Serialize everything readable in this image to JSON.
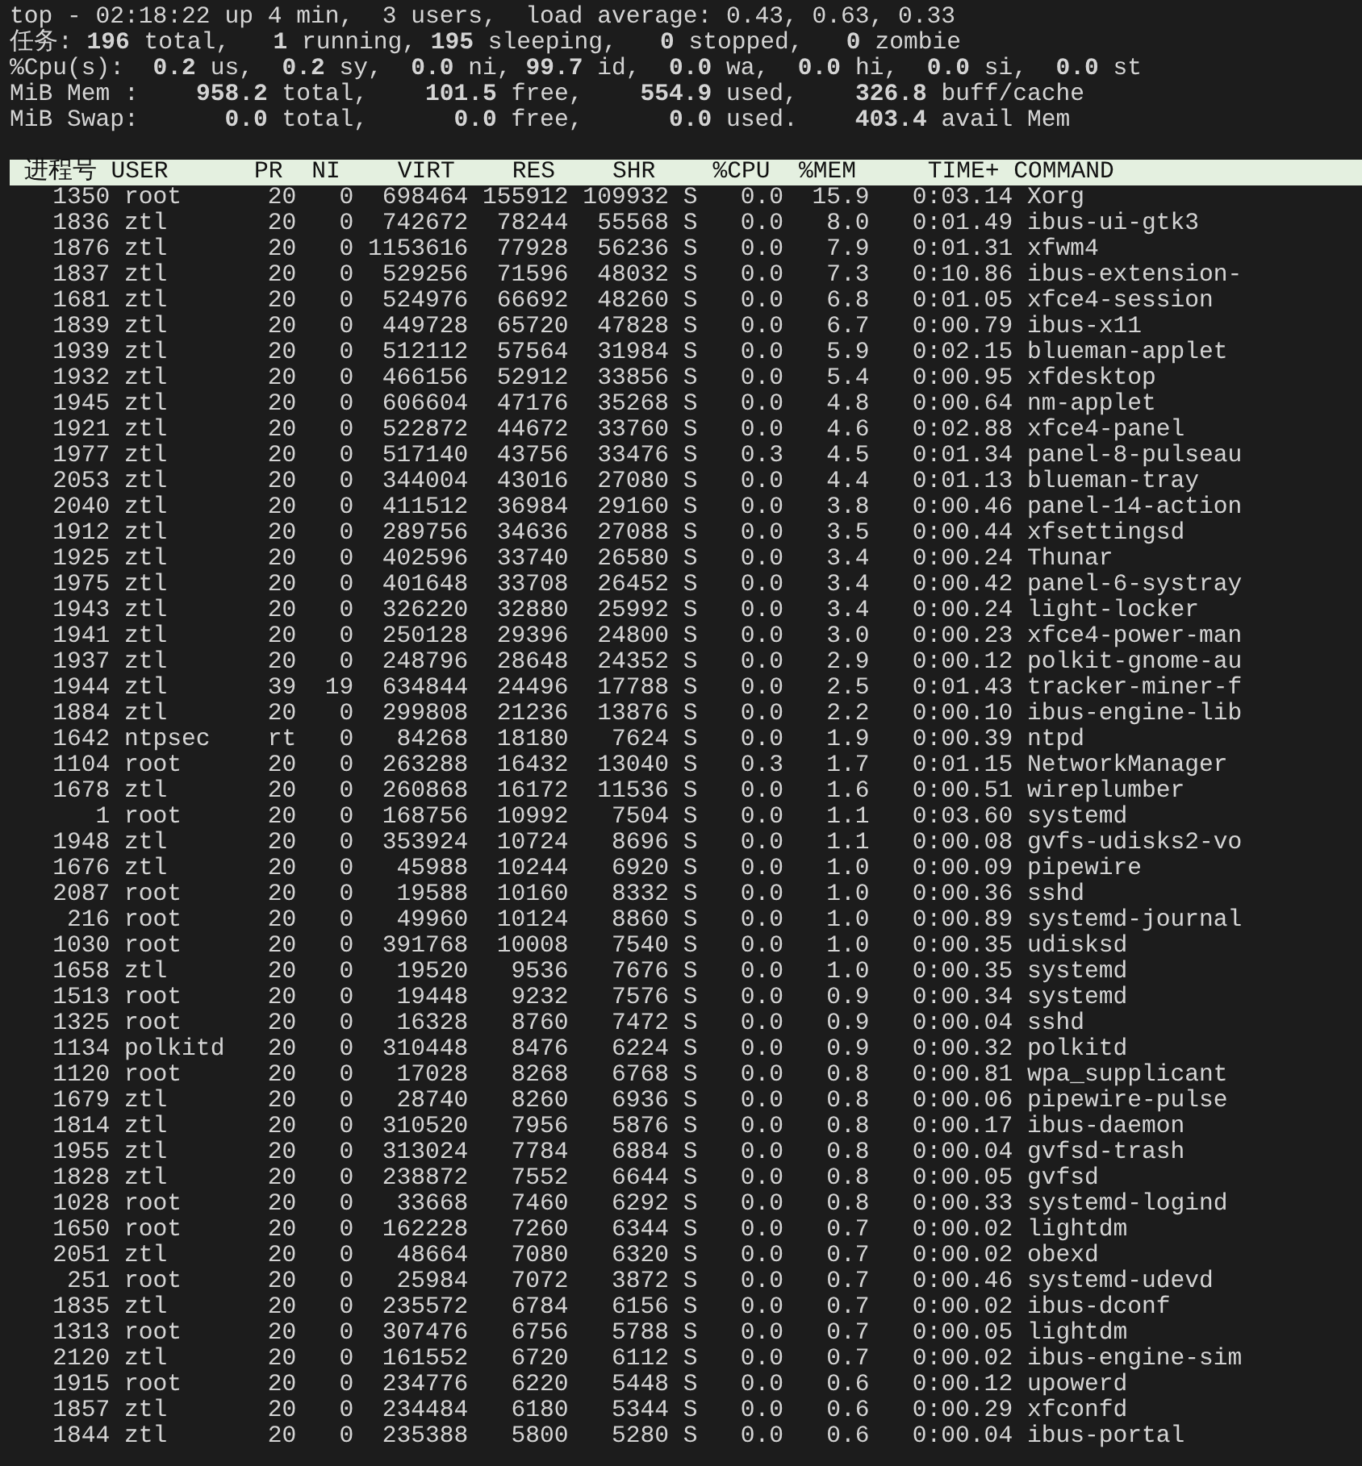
{
  "summary": [
    "top - 02:18:22 up 4 min,  3 users,  load average: 0.43, 0.63, 0.33",
    "任务: **196** total,   **1** running, **195** sleeping,   **0** stopped,   **0** zombie",
    "%Cpu(s):  **0.2** us,  **0.2** sy,  **0.0** ni, **99.7** id,  **0.0** wa,  **0.0** hi,  **0.0** si,  **0.0** st",
    "MiB Mem :    **958.2** total,    **101.5** free,    **554.9** used,    **326.8** buff/cache",
    "MiB Swap:      **0.0** total,      **0.0** free,      **0.0** used.    **403.4** avail Mem"
  ],
  "columns": [
    "进程号",
    "USER",
    "PR",
    "NI",
    "VIRT",
    "RES",
    "SHR",
    "%CPU",
    "%MEM",
    "TIME+",
    "COMMAND"
  ],
  "rows": [
    {
      "pid": "1350",
      "user": "root",
      "pr": "20",
      "ni": "0",
      "virt": "698464",
      "res": "155912",
      "shr": "109932",
      "s": "S",
      "cpu": "0.0",
      "mem": "15.9",
      "time": "0:03.14",
      "command": "Xorg"
    },
    {
      "pid": "1836",
      "user": "ztl",
      "pr": "20",
      "ni": "0",
      "virt": "742672",
      "res": "78244",
      "shr": "55568",
      "s": "S",
      "cpu": "0.0",
      "mem": "8.0",
      "time": "0:01.49",
      "command": "ibus-ui-gtk3"
    },
    {
      "pid": "1876",
      "user": "ztl",
      "pr": "20",
      "ni": "0",
      "virt": "1153616",
      "res": "77928",
      "shr": "56236",
      "s": "S",
      "cpu": "0.0",
      "mem": "7.9",
      "time": "0:01.31",
      "command": "xfwm4"
    },
    {
      "pid": "1837",
      "user": "ztl",
      "pr": "20",
      "ni": "0",
      "virt": "529256",
      "res": "71596",
      "shr": "48032",
      "s": "S",
      "cpu": "0.0",
      "mem": "7.3",
      "time": "0:10.86",
      "command": "ibus-extension-"
    },
    {
      "pid": "1681",
      "user": "ztl",
      "pr": "20",
      "ni": "0",
      "virt": "524976",
      "res": "66692",
      "shr": "48260",
      "s": "S",
      "cpu": "0.0",
      "mem": "6.8",
      "time": "0:01.05",
      "command": "xfce4-session"
    },
    {
      "pid": "1839",
      "user": "ztl",
      "pr": "20",
      "ni": "0",
      "virt": "449728",
      "res": "65720",
      "shr": "47828",
      "s": "S",
      "cpu": "0.0",
      "mem": "6.7",
      "time": "0:00.79",
      "command": "ibus-x11"
    },
    {
      "pid": "1939",
      "user": "ztl",
      "pr": "20",
      "ni": "0",
      "virt": "512112",
      "res": "57564",
      "shr": "31984",
      "s": "S",
      "cpu": "0.0",
      "mem": "5.9",
      "time": "0:02.15",
      "command": "blueman-applet"
    },
    {
      "pid": "1932",
      "user": "ztl",
      "pr": "20",
      "ni": "0",
      "virt": "466156",
      "res": "52912",
      "shr": "33856",
      "s": "S",
      "cpu": "0.0",
      "mem": "5.4",
      "time": "0:00.95",
      "command": "xfdesktop"
    },
    {
      "pid": "1945",
      "user": "ztl",
      "pr": "20",
      "ni": "0",
      "virt": "606604",
      "res": "47176",
      "shr": "35268",
      "s": "S",
      "cpu": "0.0",
      "mem": "4.8",
      "time": "0:00.64",
      "command": "nm-applet"
    },
    {
      "pid": "1921",
      "user": "ztl",
      "pr": "20",
      "ni": "0",
      "virt": "522872",
      "res": "44672",
      "shr": "33760",
      "s": "S",
      "cpu": "0.0",
      "mem": "4.6",
      "time": "0:02.88",
      "command": "xfce4-panel"
    },
    {
      "pid": "1977",
      "user": "ztl",
      "pr": "20",
      "ni": "0",
      "virt": "517140",
      "res": "43756",
      "shr": "33476",
      "s": "S",
      "cpu": "0.3",
      "mem": "4.5",
      "time": "0:01.34",
      "command": "panel-8-pulseau"
    },
    {
      "pid": "2053",
      "user": "ztl",
      "pr": "20",
      "ni": "0",
      "virt": "344004",
      "res": "43016",
      "shr": "27080",
      "s": "S",
      "cpu": "0.0",
      "mem": "4.4",
      "time": "0:01.13",
      "command": "blueman-tray"
    },
    {
      "pid": "2040",
      "user": "ztl",
      "pr": "20",
      "ni": "0",
      "virt": "411512",
      "res": "36984",
      "shr": "29160",
      "s": "S",
      "cpu": "0.0",
      "mem": "3.8",
      "time": "0:00.46",
      "command": "panel-14-action"
    },
    {
      "pid": "1912",
      "user": "ztl",
      "pr": "20",
      "ni": "0",
      "virt": "289756",
      "res": "34636",
      "shr": "27088",
      "s": "S",
      "cpu": "0.0",
      "mem": "3.5",
      "time": "0:00.44",
      "command": "xfsettingsd"
    },
    {
      "pid": "1925",
      "user": "ztl",
      "pr": "20",
      "ni": "0",
      "virt": "402596",
      "res": "33740",
      "shr": "26580",
      "s": "S",
      "cpu": "0.0",
      "mem": "3.4",
      "time": "0:00.24",
      "command": "Thunar"
    },
    {
      "pid": "1975",
      "user": "ztl",
      "pr": "20",
      "ni": "0",
      "virt": "401648",
      "res": "33708",
      "shr": "26452",
      "s": "S",
      "cpu": "0.0",
      "mem": "3.4",
      "time": "0:00.42",
      "command": "panel-6-systray"
    },
    {
      "pid": "1943",
      "user": "ztl",
      "pr": "20",
      "ni": "0",
      "virt": "326220",
      "res": "32880",
      "shr": "25992",
      "s": "S",
      "cpu": "0.0",
      "mem": "3.4",
      "time": "0:00.24",
      "command": "light-locker"
    },
    {
      "pid": "1941",
      "user": "ztl",
      "pr": "20",
      "ni": "0",
      "virt": "250128",
      "res": "29396",
      "shr": "24800",
      "s": "S",
      "cpu": "0.0",
      "mem": "3.0",
      "time": "0:00.23",
      "command": "xfce4-power-man"
    },
    {
      "pid": "1937",
      "user": "ztl",
      "pr": "20",
      "ni": "0",
      "virt": "248796",
      "res": "28648",
      "shr": "24352",
      "s": "S",
      "cpu": "0.0",
      "mem": "2.9",
      "time": "0:00.12",
      "command": "polkit-gnome-au"
    },
    {
      "pid": "1944",
      "user": "ztl",
      "pr": "39",
      "ni": "19",
      "virt": "634844",
      "res": "24496",
      "shr": "17788",
      "s": "S",
      "cpu": "0.0",
      "mem": "2.5",
      "time": "0:01.43",
      "command": "tracker-miner-f"
    },
    {
      "pid": "1884",
      "user": "ztl",
      "pr": "20",
      "ni": "0",
      "virt": "299808",
      "res": "21236",
      "shr": "13876",
      "s": "S",
      "cpu": "0.0",
      "mem": "2.2",
      "time": "0:00.10",
      "command": "ibus-engine-lib"
    },
    {
      "pid": "1642",
      "user": "ntpsec",
      "pr": "rt",
      "ni": "0",
      "virt": "84268",
      "res": "18180",
      "shr": "7624",
      "s": "S",
      "cpu": "0.0",
      "mem": "1.9",
      "time": "0:00.39",
      "command": "ntpd"
    },
    {
      "pid": "1104",
      "user": "root",
      "pr": "20",
      "ni": "0",
      "virt": "263288",
      "res": "16432",
      "shr": "13040",
      "s": "S",
      "cpu": "0.3",
      "mem": "1.7",
      "time": "0:01.15",
      "command": "NetworkManager"
    },
    {
      "pid": "1678",
      "user": "ztl",
      "pr": "20",
      "ni": "0",
      "virt": "260868",
      "res": "16172",
      "shr": "11536",
      "s": "S",
      "cpu": "0.0",
      "mem": "1.6",
      "time": "0:00.51",
      "command": "wireplumber"
    },
    {
      "pid": "1",
      "user": "root",
      "pr": "20",
      "ni": "0",
      "virt": "168756",
      "res": "10992",
      "shr": "7504",
      "s": "S",
      "cpu": "0.0",
      "mem": "1.1",
      "time": "0:03.60",
      "command": "systemd"
    },
    {
      "pid": "1948",
      "user": "ztl",
      "pr": "20",
      "ni": "0",
      "virt": "353924",
      "res": "10724",
      "shr": "8696",
      "s": "S",
      "cpu": "0.0",
      "mem": "1.1",
      "time": "0:00.08",
      "command": "gvfs-udisks2-vo"
    },
    {
      "pid": "1676",
      "user": "ztl",
      "pr": "20",
      "ni": "0",
      "virt": "45988",
      "res": "10244",
      "shr": "6920",
      "s": "S",
      "cpu": "0.0",
      "mem": "1.0",
      "time": "0:00.09",
      "command": "pipewire"
    },
    {
      "pid": "2087",
      "user": "root",
      "pr": "20",
      "ni": "0",
      "virt": "19588",
      "res": "10160",
      "shr": "8332",
      "s": "S",
      "cpu": "0.0",
      "mem": "1.0",
      "time": "0:00.36",
      "command": "sshd"
    },
    {
      "pid": "216",
      "user": "root",
      "pr": "20",
      "ni": "0",
      "virt": "49960",
      "res": "10124",
      "shr": "8860",
      "s": "S",
      "cpu": "0.0",
      "mem": "1.0",
      "time": "0:00.89",
      "command": "systemd-journal"
    },
    {
      "pid": "1030",
      "user": "root",
      "pr": "20",
      "ni": "0",
      "virt": "391768",
      "res": "10008",
      "shr": "7540",
      "s": "S",
      "cpu": "0.0",
      "mem": "1.0",
      "time": "0:00.35",
      "command": "udisksd"
    },
    {
      "pid": "1658",
      "user": "ztl",
      "pr": "20",
      "ni": "0",
      "virt": "19520",
      "res": "9536",
      "shr": "7676",
      "s": "S",
      "cpu": "0.0",
      "mem": "1.0",
      "time": "0:00.35",
      "command": "systemd"
    },
    {
      "pid": "1513",
      "user": "root",
      "pr": "20",
      "ni": "0",
      "virt": "19448",
      "res": "9232",
      "shr": "7576",
      "s": "S",
      "cpu": "0.0",
      "mem": "0.9",
      "time": "0:00.34",
      "command": "systemd"
    },
    {
      "pid": "1325",
      "user": "root",
      "pr": "20",
      "ni": "0",
      "virt": "16328",
      "res": "8760",
      "shr": "7472",
      "s": "S",
      "cpu": "0.0",
      "mem": "0.9",
      "time": "0:00.04",
      "command": "sshd"
    },
    {
      "pid": "1134",
      "user": "polkitd",
      "pr": "20",
      "ni": "0",
      "virt": "310448",
      "res": "8476",
      "shr": "6224",
      "s": "S",
      "cpu": "0.0",
      "mem": "0.9",
      "time": "0:00.32",
      "command": "polkitd"
    },
    {
      "pid": "1120",
      "user": "root",
      "pr": "20",
      "ni": "0",
      "virt": "17028",
      "res": "8268",
      "shr": "6768",
      "s": "S",
      "cpu": "0.0",
      "mem": "0.8",
      "time": "0:00.81",
      "command": "wpa_supplicant"
    },
    {
      "pid": "1679",
      "user": "ztl",
      "pr": "20",
      "ni": "0",
      "virt": "28740",
      "res": "8260",
      "shr": "6936",
      "s": "S",
      "cpu": "0.0",
      "mem": "0.8",
      "time": "0:00.06",
      "command": "pipewire-pulse"
    },
    {
      "pid": "1814",
      "user": "ztl",
      "pr": "20",
      "ni": "0",
      "virt": "310520",
      "res": "7956",
      "shr": "5876",
      "s": "S",
      "cpu": "0.0",
      "mem": "0.8",
      "time": "0:00.17",
      "command": "ibus-daemon"
    },
    {
      "pid": "1955",
      "user": "ztl",
      "pr": "20",
      "ni": "0",
      "virt": "313024",
      "res": "7784",
      "shr": "6884",
      "s": "S",
      "cpu": "0.0",
      "mem": "0.8",
      "time": "0:00.04",
      "command": "gvfsd-trash"
    },
    {
      "pid": "1828",
      "user": "ztl",
      "pr": "20",
      "ni": "0",
      "virt": "238872",
      "res": "7552",
      "shr": "6644",
      "s": "S",
      "cpu": "0.0",
      "mem": "0.8",
      "time": "0:00.05",
      "command": "gvfsd"
    },
    {
      "pid": "1028",
      "user": "root",
      "pr": "20",
      "ni": "0",
      "virt": "33668",
      "res": "7460",
      "shr": "6292",
      "s": "S",
      "cpu": "0.0",
      "mem": "0.8",
      "time": "0:00.33",
      "command": "systemd-logind"
    },
    {
      "pid": "1650",
      "user": "root",
      "pr": "20",
      "ni": "0",
      "virt": "162228",
      "res": "7260",
      "shr": "6344",
      "s": "S",
      "cpu": "0.0",
      "mem": "0.7",
      "time": "0:00.02",
      "command": "lightdm"
    },
    {
      "pid": "2051",
      "user": "ztl",
      "pr": "20",
      "ni": "0",
      "virt": "48664",
      "res": "7080",
      "shr": "6320",
      "s": "S",
      "cpu": "0.0",
      "mem": "0.7",
      "time": "0:00.02",
      "command": "obexd"
    },
    {
      "pid": "251",
      "user": "root",
      "pr": "20",
      "ni": "0",
      "virt": "25984",
      "res": "7072",
      "shr": "3872",
      "s": "S",
      "cpu": "0.0",
      "mem": "0.7",
      "time": "0:00.46",
      "command": "systemd-udevd"
    },
    {
      "pid": "1835",
      "user": "ztl",
      "pr": "20",
      "ni": "0",
      "virt": "235572",
      "res": "6784",
      "shr": "6156",
      "s": "S",
      "cpu": "0.0",
      "mem": "0.7",
      "time": "0:00.02",
      "command": "ibus-dconf"
    },
    {
      "pid": "1313",
      "user": "root",
      "pr": "20",
      "ni": "0",
      "virt": "307476",
      "res": "6756",
      "shr": "5788",
      "s": "S",
      "cpu": "0.0",
      "mem": "0.7",
      "time": "0:00.05",
      "command": "lightdm"
    },
    {
      "pid": "2120",
      "user": "ztl",
      "pr": "20",
      "ni": "0",
      "virt": "161552",
      "res": "6720",
      "shr": "6112",
      "s": "S",
      "cpu": "0.0",
      "mem": "0.7",
      "time": "0:00.02",
      "command": "ibus-engine-sim"
    },
    {
      "pid": "1915",
      "user": "root",
      "pr": "20",
      "ni": "0",
      "virt": "234776",
      "res": "6220",
      "shr": "5448",
      "s": "S",
      "cpu": "0.0",
      "mem": "0.6",
      "time": "0:00.12",
      "command": "upowerd"
    },
    {
      "pid": "1857",
      "user": "ztl",
      "pr": "20",
      "ni": "0",
      "virt": "234484",
      "res": "6180",
      "shr": "5344",
      "s": "S",
      "cpu": "0.0",
      "mem": "0.6",
      "time": "0:00.29",
      "command": "xfconfd"
    },
    {
      "pid": "1844",
      "user": "ztl",
      "pr": "20",
      "ni": "0",
      "virt": "235388",
      "res": "5800",
      "shr": "5280",
      "s": "S",
      "cpu": "0.0",
      "mem": "0.6",
      "time": "0:00.04",
      "command": "ibus-portal"
    }
  ]
}
